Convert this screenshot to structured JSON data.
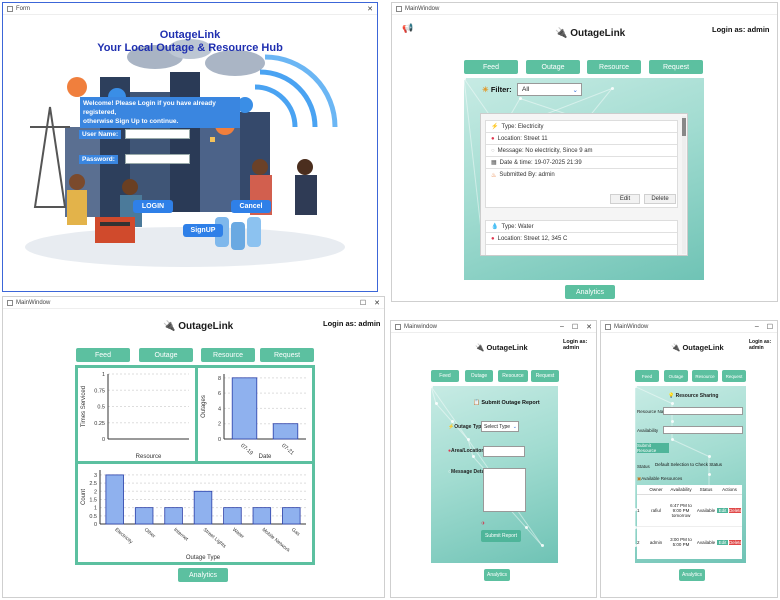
{
  "login_window": {
    "title": "Form",
    "app_title": "OutageLink",
    "subtitle": "Your Local Outage & Resource Hub",
    "welcome_line1": "Welcome! Please Login if you have already registered,",
    "welcome_line2": "otherwise Sign Up to continue.",
    "username_label": "User Name:",
    "password_label": "Password:",
    "login_label": "LOGIN",
    "cancel_label": "Cancel",
    "signup_label": "SignUP"
  },
  "feed_window": {
    "title": "MainWindow",
    "app_name": "OutageLink",
    "login_as": "Login as: admin",
    "nav": [
      "Feed",
      "Outage",
      "Resource",
      "Request"
    ],
    "filter_label": "Filter:",
    "filter_value": "All",
    "post1": {
      "type": "Type: Electricity",
      "location": "Location: Street 11",
      "message": "Message: No electricity, Since 9 am",
      "datetime": "Date & time: 19-07-2025 21:39",
      "submitted": "Submitted By: admin",
      "edit": "Edit",
      "delete": "Delete"
    },
    "post2": {
      "type": "Type: Water",
      "location": "Location: Street 12, 345 C"
    },
    "analytics": "Analytics"
  },
  "analytics_window": {
    "title": "MainWindow",
    "app_name": "OutageLink",
    "login_as": "Login as: admin",
    "nav": [
      "Feed",
      "Outage",
      "Resource",
      "Request"
    ],
    "analytics": "Analytics"
  },
  "chart_data": [
    {
      "type": "bar",
      "xlabel": "Resource",
      "ylabel": "Times Serviced",
      "categories": [],
      "values": [],
      "ylim": [
        0,
        1
      ],
      "yticks": [
        "0",
        "0.25",
        "0.5",
        "0.75",
        "1"
      ]
    },
    {
      "type": "bar",
      "xlabel": "Date",
      "ylabel": "Outages",
      "categories": [
        "07-19",
        "07-21"
      ],
      "values": [
        8,
        2
      ],
      "ylim": [
        0,
        8.5
      ],
      "yticks": [
        "0",
        "2",
        "4",
        "6",
        "8"
      ]
    },
    {
      "type": "bar",
      "xlabel": "Outage Type",
      "ylabel": "Count",
      "categories": [
        "Electricity",
        "Other",
        "Internet",
        "Street Lights",
        "Water",
        "Mobile Network",
        "Gas"
      ],
      "values": [
        3,
        1,
        1,
        2,
        1,
        1,
        1
      ],
      "ylim": [
        0,
        3.3
      ],
      "yticks": [
        "0",
        "0.5",
        "1",
        "1.5",
        "2",
        "2.5",
        "3"
      ]
    }
  ],
  "submit_window": {
    "title": "Mainwindow",
    "app_name": "OutageLink",
    "login_as": "Login as: admin",
    "nav": [
      "Feed",
      "Outage",
      "Resource",
      "Request"
    ],
    "header": "Submit Outage Report",
    "outage_type_label": "Outage Type:",
    "outage_type_value": "Select Type",
    "area_label": "Area/Location",
    "message_label": "Message Details",
    "submit_label": "Submit Report",
    "analytics": "Analytics"
  },
  "resource_window": {
    "title": "MainWindow",
    "app_name": "OutageLink",
    "login_as": "Login as: admin",
    "nav": [
      "Feed",
      "Outage",
      "Resource",
      "Request"
    ],
    "header": "Resource Sharing",
    "resource_name_label": "Resource Name",
    "availability_label": "Availability",
    "submit_label": "Submit Resource",
    "status_label": "Status",
    "status_default": "Default Selection to Check Status",
    "available_label": "Available Resources",
    "table_headers": [
      "",
      "Owner",
      "Availability",
      "Status",
      "Actions"
    ],
    "rows": [
      {
        "idx": "1",
        "owner": "rafiul",
        "availability": "6:47 PM to 9:00 PM tomorrow",
        "status": "Available",
        "edit": "Edit",
        "delete": "Delete"
      },
      {
        "idx": "2",
        "owner": "admin",
        "availability": "3:00 PM to 5:00 PM",
        "status": "Available",
        "edit": "Edit",
        "delete": "Delete"
      }
    ],
    "analytics": "Analytics"
  }
}
